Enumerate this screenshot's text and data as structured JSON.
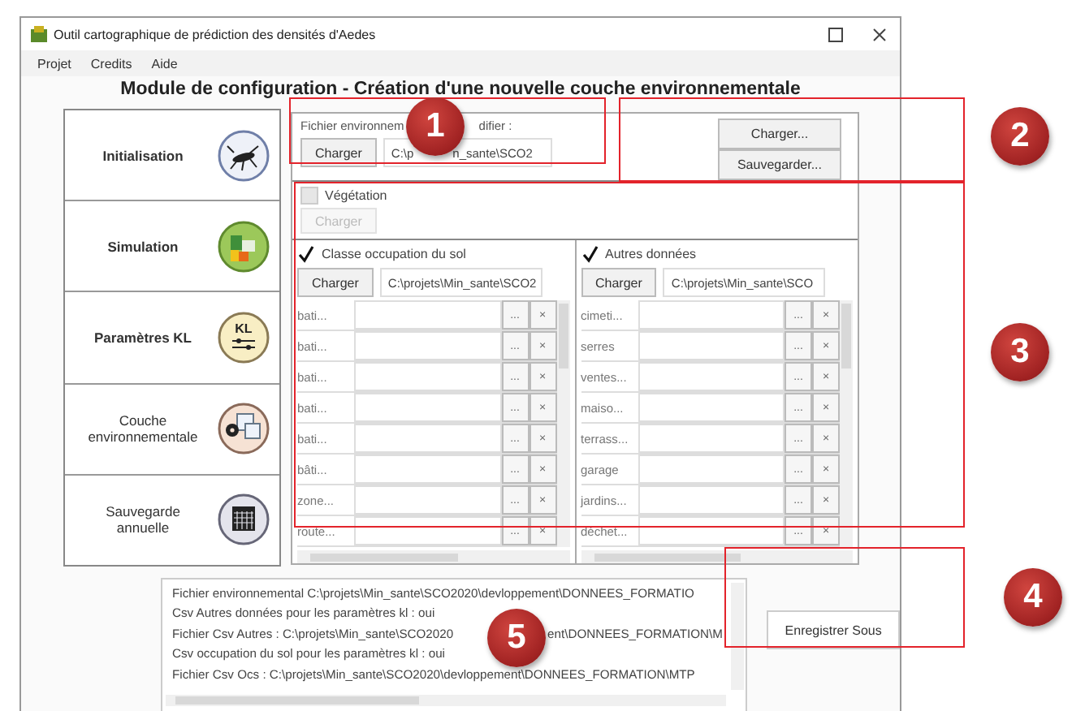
{
  "window": {
    "title": "Outil cartographique de prédiction des densités d'Aedes"
  },
  "menu": [
    "Projet",
    "Credits",
    "Aide"
  ],
  "heading": "Module de configuration - Création d'une nouvelle couche environnementale",
  "sidebar": [
    {
      "label": "Initialisation",
      "kind": "insect"
    },
    {
      "label": "Simulation",
      "kind": "chart"
    },
    {
      "label": "Paramètres KL",
      "kind": "sliders",
      "icon_text": "KL"
    },
    {
      "label": "Couche environnementale",
      "kind": "layers"
    },
    {
      "label": "Sauvegarde annuelle",
      "kind": "calendar"
    }
  ],
  "env_file": {
    "label_parts": [
      "Fichier environnem",
      "difier :"
    ],
    "button": "Charger",
    "path_parts": [
      "C:\\p",
      "n_sante\\SCO2"
    ]
  },
  "config_buttons": [
    "Charger...",
    "Sauvegarder..."
  ],
  "vegetation": {
    "label": "Végétation",
    "checked": false,
    "button": "Charger",
    "disabled": true
  },
  "columns": [
    {
      "label": "Classe occupation du sol",
      "checked": true,
      "button": "Charger",
      "path": "C:\\projets\\Min_sante\\SCO2",
      "rows": [
        {
          "name": "bati...",
          "browse": "...",
          "clear": "×"
        },
        {
          "name": "bati...",
          "browse": "...",
          "clear": "×"
        },
        {
          "name": "bati...",
          "browse": "...",
          "clear": "×"
        },
        {
          "name": "bati...",
          "browse": "...",
          "clear": "×"
        },
        {
          "name": "bati...",
          "browse": "...",
          "clear": "×"
        },
        {
          "name": "bâti...",
          "browse": "...",
          "clear": "×"
        },
        {
          "name": "zone...",
          "browse": "...",
          "clear": "×"
        },
        {
          "name": "route...",
          "browse": "...",
          "clear": "×"
        }
      ]
    },
    {
      "label": "Autres données",
      "checked": true,
      "button": "Charger",
      "path": "C:\\projets\\Min_sante\\SCO",
      "rows": [
        {
          "name": "cimeti...",
          "browse": "...",
          "clear": "×"
        },
        {
          "name": "serres",
          "browse": "...",
          "clear": "×"
        },
        {
          "name": "ventes...",
          "browse": "...",
          "clear": "×"
        },
        {
          "name": "maiso...",
          "browse": "...",
          "clear": "×"
        },
        {
          "name": "terrass...",
          "browse": "...",
          "clear": "×"
        },
        {
          "name": "garage",
          "browse": "...",
          "clear": "×"
        },
        {
          "name": "jardins...",
          "browse": "...",
          "clear": "×"
        },
        {
          "name": "déchet...",
          "browse": "...",
          "clear": "×"
        }
      ]
    }
  ],
  "log": [
    {
      "parts": [
        "Fichier environnemental C:\\projets\\Min_sante\\SCO2020\\devloppement\\DONNEES_FORMATIO"
      ]
    },
    {
      "parts": [
        "Csv Autres données pour les paramètres kl : oui"
      ]
    },
    {
      "parts": [
        "Fichier Csv Autres  : C:\\projets\\Min_sante\\SCO2020",
        "ent\\DONNEES_FORMATION\\M"
      ]
    },
    {
      "parts": [
        "Csv occupation du sol pour les paramètres kl : oui"
      ]
    },
    {
      "parts": [
        "Fichier Csv Ocs  : C:\\projets\\Min_sante\\SCO2020\\devloppement\\DONNEES_FORMATION\\MTP"
      ]
    }
  ],
  "save_as_button": "Enregistrer Sous",
  "callouts": [
    "1",
    "2",
    "3",
    "4",
    "5"
  ]
}
